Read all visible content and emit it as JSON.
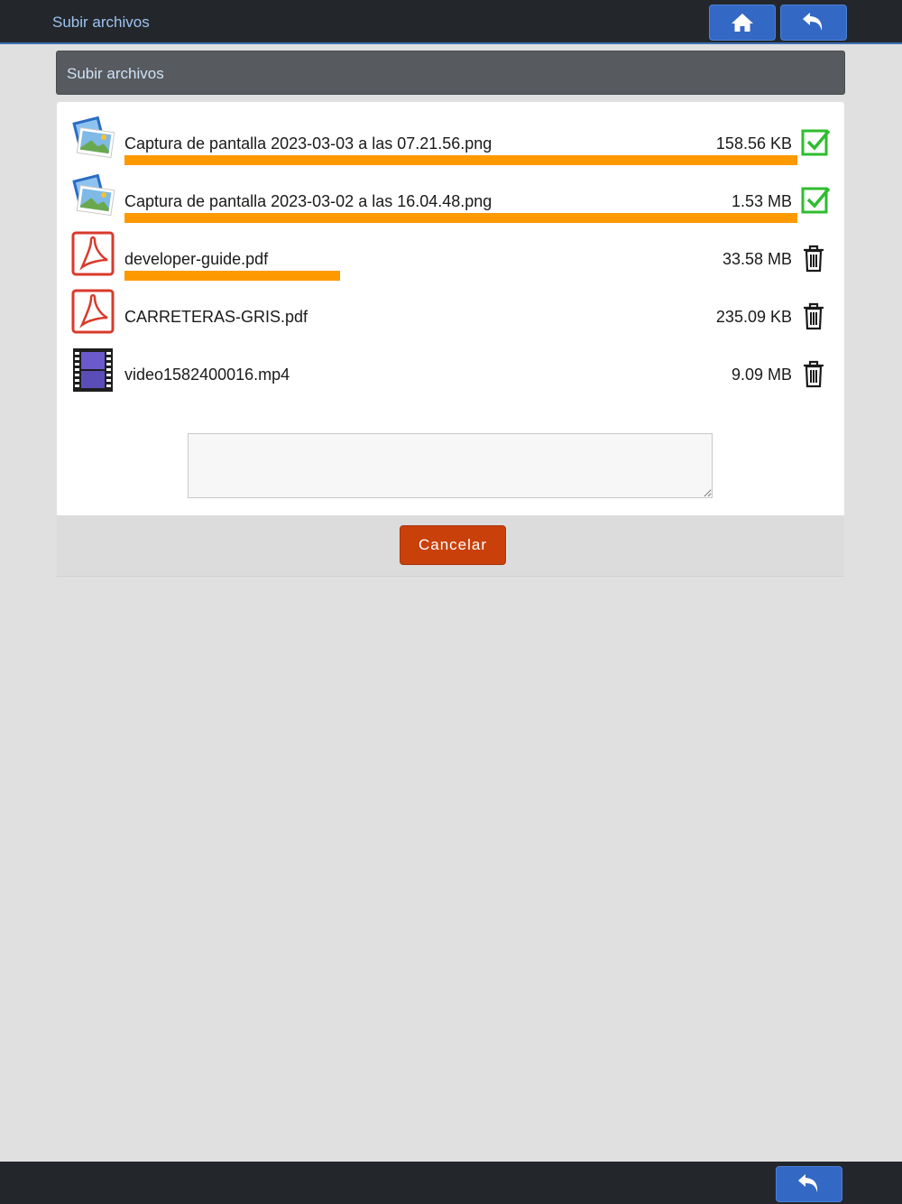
{
  "header": {
    "title": "Subir archivos",
    "home_icon": "home-icon",
    "back_icon": "undo-arrow-icon"
  },
  "panel": {
    "title": "Subir archivos"
  },
  "files": [
    {
      "name": "Captura de pantalla 2023-03-03 a las 07.21.56.png",
      "size": "158.56 KB",
      "type_icon": "image-file-icon",
      "progress": 1.0,
      "status": "done"
    },
    {
      "name": "Captura de pantalla 2023-03-02 a las 16.04.48.png",
      "size": "1.53 MB",
      "type_icon": "image-file-icon",
      "progress": 1.0,
      "status": "done"
    },
    {
      "name": "developer-guide.pdf",
      "size": "33.58 MB",
      "type_icon": "pdf-file-icon",
      "progress": 0.32,
      "status": "uploading"
    },
    {
      "name": "CARRETERAS-GRIS.pdf",
      "size": "235.09 KB",
      "type_icon": "pdf-file-icon",
      "progress": 0,
      "status": "pending"
    },
    {
      "name": "video1582400016.mp4",
      "size": "9.09 MB",
      "type_icon": "video-file-icon",
      "progress": 0,
      "status": "pending"
    }
  ],
  "notes": {
    "value": "",
    "placeholder": ""
  },
  "actions": {
    "cancel_label": "Cancelar"
  },
  "colors": {
    "topbar": "#23272b",
    "button_blue": "#3369c4",
    "progress": "#ff9900",
    "check": "#2ebd2e",
    "cancel": "#c9400b"
  }
}
